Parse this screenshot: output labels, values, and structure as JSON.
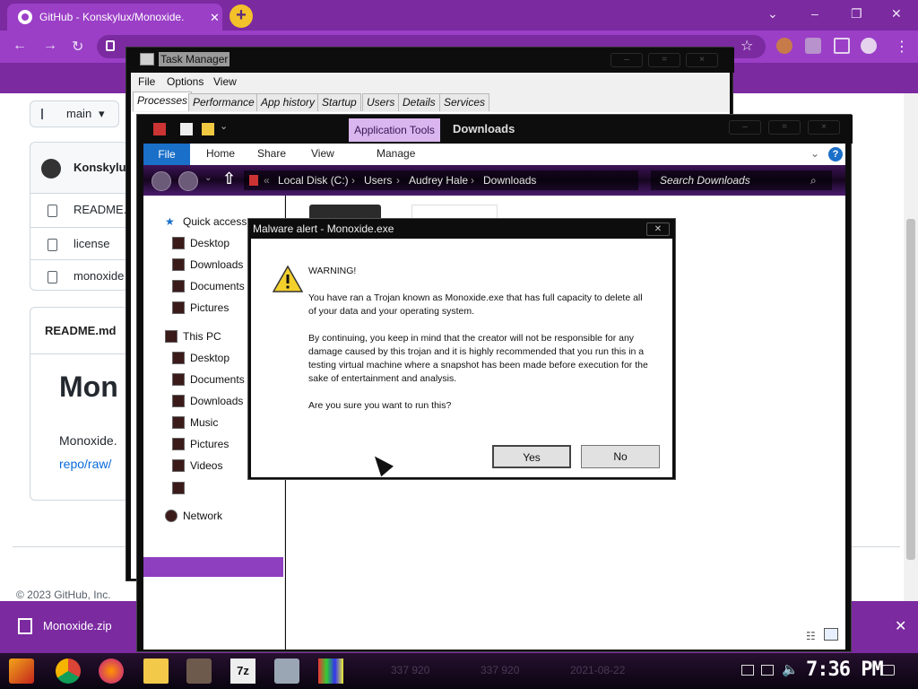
{
  "browser": {
    "tab_title": "GitHub - Konskylux/Monoxide.",
    "tab_close": "✕",
    "new_tab": "+",
    "download_file": "Monoxide.zip"
  },
  "github": {
    "branch": "main",
    "owner": "Konskylu",
    "files": [
      "README.",
      "license",
      "monoxide"
    ],
    "readme_header": "README.md",
    "readme_h1": "Mon",
    "readme_text": "Monoxide.",
    "readme_link": "repo/raw/",
    "footer": "© 2023 GitHub, Inc."
  },
  "taskmgr": {
    "title": "Task Manager",
    "menus": [
      "File",
      "Options",
      "View"
    ],
    "tabs": [
      "Processes",
      "Performance",
      "App history",
      "Startup",
      "Users",
      "Details",
      "Services"
    ]
  },
  "explorer": {
    "app_tools": "Application Tools",
    "title": "Downloads",
    "ribbon": {
      "file": "File",
      "home": "Home",
      "share": "Share",
      "view": "View",
      "manage": "Manage"
    },
    "breadcrumb": [
      "Local Disk (C:)",
      "Users",
      "Audrey Hale",
      "Downloads"
    ],
    "search_placeholder": "Search Downloads",
    "nav": {
      "quick_access": "Quick access",
      "quick_items": [
        "Desktop",
        "Downloads",
        "Documents",
        "Pictures"
      ],
      "this_pc": "This PC",
      "pc_items": [
        "Desktop",
        "Documents",
        "Downloads",
        "Music",
        "Pictures",
        "Videos"
      ],
      "local_disk": "Local Disk (C:)",
      "network": "Network"
    }
  },
  "dialog": {
    "title": "Malware alert - Monoxide.exe",
    "close": "✕",
    "heading": "WARNING!",
    "para1": "You have ran a Trojan known as Monoxide.exe that has full capacity to delete all of your data and your operating system.",
    "para2": "By continuing, you keep in mind that the creator will not be responsible for any damage caused by this trojan and it is highly recommended that you run this in a testing virtual machine where a snapshot has been made before execution for the sake of entertainment and analysis.",
    "question": "Are you sure you want to run this?",
    "yes": "Yes",
    "no": "No"
  },
  "taskbar": {
    "ghost_values": [
      "337 920",
      "337 920",
      "2021-08-22"
    ],
    "clock": "7:36 PM"
  },
  "colors": {
    "accent_purple": "#7b2aa0",
    "selected_purple": "#8e3fbf",
    "ribbon_blue": "#1a6fc9"
  }
}
